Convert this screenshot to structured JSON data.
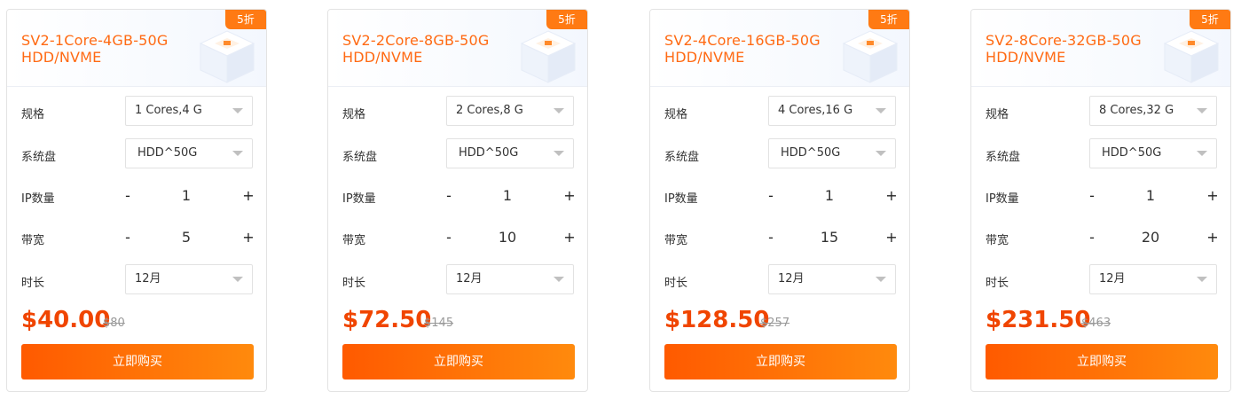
{
  "cards": [
    {
      "badge": "5折",
      "title_line1": "SV2-1Core-4GB-50G",
      "title_line2": "HDD/NVME",
      "spec_label": "规格",
      "spec_value": "1 Cores,4 G",
      "disk_label": "系统盘",
      "disk_value": "HDD^50G",
      "ip_label": "IP数量",
      "ip_value": "1",
      "bw_label": "带宽",
      "bw_value": "5",
      "dur_label": "时长",
      "dur_value": "12月",
      "minus": "-",
      "plus": "+",
      "price": "$40.00",
      "old_price": "$80",
      "buy_label": "立即购买"
    },
    {
      "badge": "5折",
      "title_line1": "SV2-2Core-8GB-50G",
      "title_line2": "HDD/NVME",
      "spec_label": "规格",
      "spec_value": "2 Cores,8 G",
      "disk_label": "系统盘",
      "disk_value": "HDD^50G",
      "ip_label": "IP数量",
      "ip_value": "1",
      "bw_label": "带宽",
      "bw_value": "10",
      "dur_label": "时长",
      "dur_value": "12月",
      "minus": "-",
      "plus": "+",
      "price": "$72.50",
      "old_price": "$145",
      "buy_label": "立即购买"
    },
    {
      "badge": "5折",
      "title_line1": "SV2-4Core-16GB-50G",
      "title_line2": "HDD/NVME",
      "spec_label": "规格",
      "spec_value": "4 Cores,16 G",
      "disk_label": "系统盘",
      "disk_value": "HDD^50G",
      "ip_label": "IP数量",
      "ip_value": "1",
      "bw_label": "带宽",
      "bw_value": "15",
      "dur_label": "时长",
      "dur_value": "12月",
      "minus": "-",
      "plus": "+",
      "price": "$128.50",
      "old_price": "$257",
      "buy_label": "立即购买"
    },
    {
      "badge": "5折",
      "title_line1": "SV2-8Core-32GB-50G",
      "title_line2": "HDD/NVME",
      "spec_label": "规格",
      "spec_value": "8 Cores,32 G",
      "disk_label": "系统盘",
      "disk_value": "HDD^50G",
      "ip_label": "IP数量",
      "ip_value": "1",
      "bw_label": "带宽",
      "bw_value": "20",
      "dur_label": "时长",
      "dur_value": "12月",
      "minus": "-",
      "plus": "+",
      "price": "$231.50",
      "old_price": "$463",
      "buy_label": "立即购买"
    }
  ],
  "icons": {
    "dropdown": "chevron-down-icon",
    "server": "server-illustration-icon"
  },
  "colors": {
    "accent": "#ff6a13",
    "price": "#f04500",
    "badge": "#ff7a13",
    "button_start": "#ff5a00",
    "button_end": "#ff8a0d"
  }
}
